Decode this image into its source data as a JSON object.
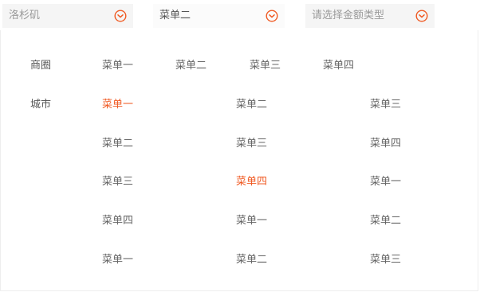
{
  "filters": [
    {
      "id": "city",
      "value": "洛杉矶",
      "placeholder": true
    },
    {
      "id": "menu",
      "value": "菜单二",
      "placeholder": false
    },
    {
      "id": "amount",
      "value": "请选择金额类型",
      "placeholder": true
    }
  ],
  "colors": {
    "accent": "#f05a23",
    "text": "#666666",
    "placeholder": "#999999",
    "select_bg": "#f5f5f5"
  },
  "icons": {
    "chevron": "chevron-down-circle-icon"
  },
  "district": {
    "label": "商圈",
    "items": [
      "菜单一",
      "菜单二",
      "菜单三",
      "菜单四"
    ]
  },
  "city": {
    "label": "城市",
    "rows": [
      [
        "菜单一",
        "菜单二",
        "菜单三"
      ],
      [
        "菜单二",
        "菜单三",
        "菜单四"
      ],
      [
        "菜单三",
        "菜单四",
        "菜单一"
      ],
      [
        "菜单四",
        "菜单一",
        "菜单二"
      ],
      [
        "菜单一",
        "菜单二",
        "菜单三"
      ]
    ],
    "active": [
      [
        0,
        0
      ],
      [
        2,
        1
      ]
    ]
  }
}
